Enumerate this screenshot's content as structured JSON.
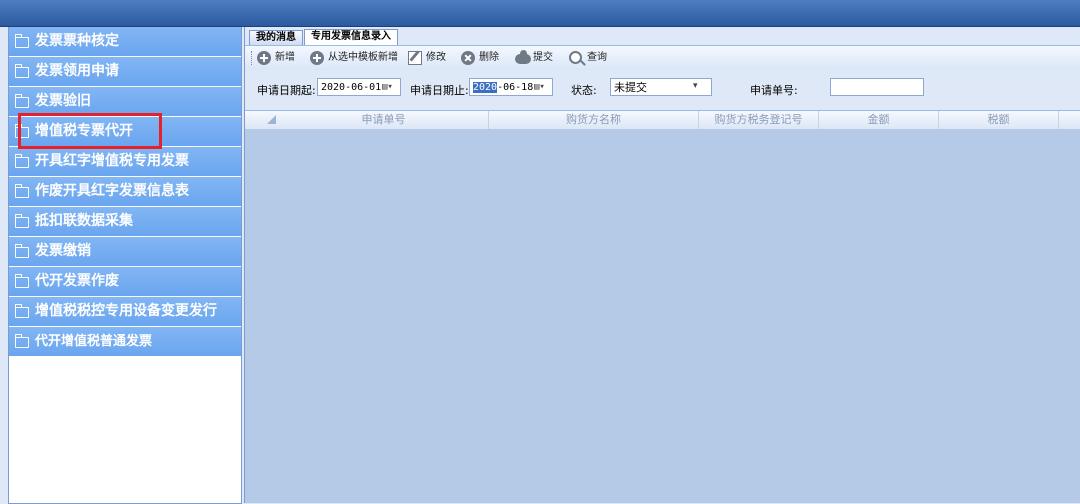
{
  "sidebar": {
    "items": [
      {
        "label": "发票票种核定"
      },
      {
        "label": "发票领用申请"
      },
      {
        "label": "发票验旧"
      },
      {
        "label": "增值税专票代开"
      },
      {
        "label": "开具红字增值税专用发票"
      },
      {
        "label": "作废开具红字发票信息表"
      },
      {
        "label": "抵扣联数据采集"
      },
      {
        "label": "发票缴销"
      },
      {
        "label": "代开发票作废"
      },
      {
        "label": "增值税税控专用设备变更发行"
      },
      {
        "label": "代开增值税普通发票"
      }
    ]
  },
  "tabs": [
    {
      "label": "我的消息"
    },
    {
      "label": "专用发票信息录入"
    }
  ],
  "toolbar": {
    "add_label": "新增",
    "add_from_template_label": "从选中模板新增",
    "edit_label": "修改",
    "delete_label": "删除",
    "submit_label": "提交",
    "query_label": "查询"
  },
  "form": {
    "date_from_label": "申请日期起:",
    "date_from_value": "2020-06-01",
    "date_to_label": "申请日期止:",
    "date_to_selected": "2020",
    "date_to_rest": "-06-18",
    "status_label": "状态:",
    "status_value": "未提交",
    "app_no_label": "申请单号:",
    "app_no_value": ""
  },
  "grid": {
    "columns": [
      "申请单号",
      "购货方名称",
      "购货方税务登记号",
      "金额",
      "税额"
    ]
  },
  "colors": {
    "nav_bg": "#6aa5ef",
    "highlight": "#e8202a",
    "grid_bg": "#b5cae6"
  }
}
